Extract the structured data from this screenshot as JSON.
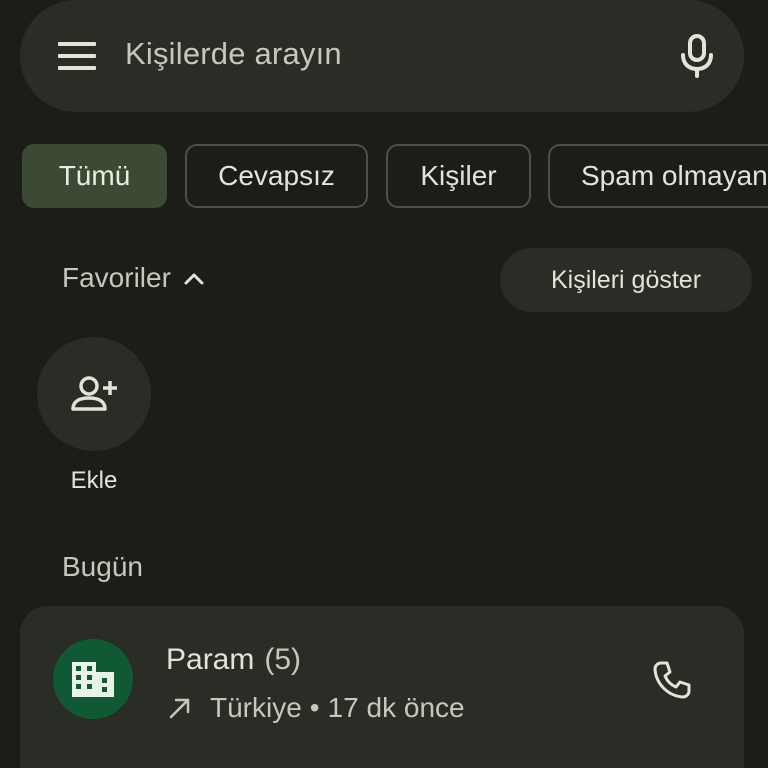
{
  "search": {
    "placeholder": "Kişilerde arayın",
    "menu_icon": "menu-icon",
    "mic_icon": "mic-icon"
  },
  "filters": {
    "chips": [
      {
        "label": "Tümü",
        "selected": true
      },
      {
        "label": "Cevapsız",
        "selected": false
      },
      {
        "label": "Kişiler",
        "selected": false
      },
      {
        "label": "Spam olmayan",
        "selected": false
      }
    ]
  },
  "favorites": {
    "title": "Favoriler",
    "show_contacts_label": "Kişileri göster",
    "add_label": "Ekle",
    "add_icon": "person-add-icon"
  },
  "today": {
    "section_title": "Bugün",
    "entries": [
      {
        "name": "Param",
        "count": "(5)",
        "direction_icon": "outgoing-call-icon",
        "location": "Türkiye",
        "separator": "•",
        "time": "17 dk önce",
        "avatar_icon": "business-icon",
        "action_icon": "phone-icon"
      }
    ]
  },
  "colors": {
    "background": "#1b1d18",
    "surface": "#2a2d25",
    "selected_chip": "#3c4a35",
    "avatar_green": "#0f5a35",
    "text_primary": "#e2e4da",
    "text_secondary": "#c5c8bb"
  }
}
